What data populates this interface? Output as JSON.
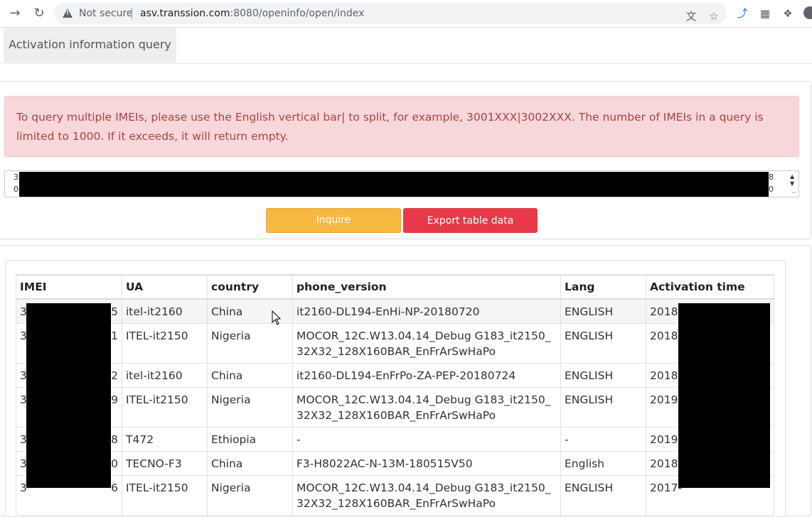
{
  "browser": {
    "security_label": "Not secure",
    "url_host": "asv.transsion.com",
    "url_path": ":8080/openinfo/open/index"
  },
  "page": {
    "tab_label": "Activation information query",
    "alert_text": "To query multiple IMEIs, please use the English vertical bar| to split, for example, 3001XXX|3002XXX. The number of IMEIs in a query is limited to 1000. If it exceeds, it will return empty.",
    "textarea_left_chars": [
      "3",
      "0"
    ],
    "textarea_right_chars": [
      "8",
      "0"
    ],
    "inquire_label": "Inquire",
    "export_label": "Export table data"
  },
  "table": {
    "headers": [
      "IMEI",
      "UA",
      "country",
      "phone_version",
      "Lang",
      "Activation time"
    ],
    "rows": [
      {
        "imei_start": "3",
        "imei_end": "5",
        "ua": "itel-it2160",
        "country": "China",
        "phone_version": "it2160-DL194-EnHi-NP-20180720",
        "lang": "ENGLISH",
        "time": "2018-"
      },
      {
        "imei_start": "3",
        "imei_end": "1",
        "ua": "ITEL-it2150",
        "country": "Nigeria",
        "phone_version": "MOCOR_12C.W13.04.14_Debug G183_it2150_32X32_128X160BAR_EnFrArSwHaPo",
        "lang": "ENGLISH",
        "time": "2018-"
      },
      {
        "imei_start": "3",
        "imei_end": "2",
        "ua": "itel-it2160",
        "country": "China",
        "phone_version": "it2160-DL194-EnFrPo-ZA-PEP-20180724",
        "lang": "ENGLISH",
        "time": "2018-"
      },
      {
        "imei_start": "3",
        "imei_end": "9",
        "ua": "ITEL-it2150",
        "country": "Nigeria",
        "phone_version": "MOCOR_12C.W13.04.14_Debug G183_it2150_32X32_128X160BAR_EnFrArSwHaPo",
        "lang": "ENGLISH",
        "time": "2019-"
      },
      {
        "imei_start": "3",
        "imei_end": "8",
        "ua": "T472",
        "country": "Ethiopia",
        "phone_version": "-",
        "lang": "-",
        "time": "2019-"
      },
      {
        "imei_start": "3",
        "imei_end": "0",
        "ua": "TECNO-F3",
        "country": "China",
        "phone_version": "F3-H8022AC-N-13M-180515V50",
        "lang": "English",
        "time": "2018-"
      },
      {
        "imei_start": "3",
        "imei_end": "6",
        "ua": "ITEL-it2150",
        "country": "Nigeria",
        "phone_version": "MOCOR_12C.W13.04.14_Debug G183_it2150_32X32_128X160BAR_EnFrArSwHaPo",
        "lang": "ENGLISH",
        "time": "2017-"
      }
    ]
  },
  "colors": {
    "alert_bg": "#f8d7da",
    "alert_text": "#a94442",
    "inquire_bg": "#f7b842",
    "export_bg": "#e8394a"
  }
}
